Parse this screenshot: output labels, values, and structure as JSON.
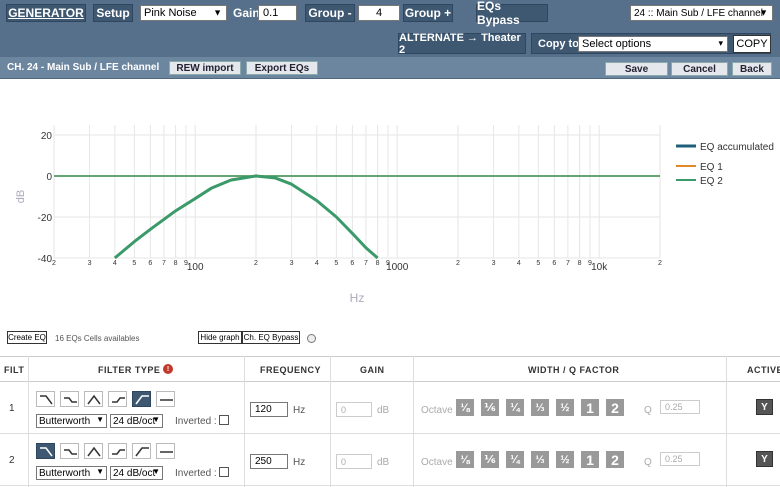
{
  "toolbar": {
    "generator_label": "GENERATOR",
    "setup_label": "Setup",
    "noise_select": "Pink Noise",
    "gain_label": "Gain",
    "gain_value": "0.1",
    "group_minus_label": "Group -",
    "group_value": "4",
    "group_plus_label": "Group +",
    "eqs_bypass_label": "EQs Bypass",
    "channel_select": "24 :: Main Sub / LFE channel",
    "alternate_label": "ALTERNATE → Theater 2",
    "copy_to_label": "Copy to :",
    "copy_select": "Select options",
    "copy_button": "COPY"
  },
  "subbar": {
    "channel_title": "CH. 24 - Main Sub / LFE channel",
    "rew_import": "REW import",
    "export_eqs": "Export EQs",
    "save": "Save",
    "cancel": "Cancel",
    "back": "Back"
  },
  "chart_data": {
    "type": "line",
    "xlabel": "Hz",
    "ylabel": "dB",
    "xscale": "log",
    "xlim": [
      20,
      20000
    ],
    "ylim": [
      -40,
      20
    ],
    "yticks": [
      20,
      0,
      -20,
      -40
    ],
    "xtick_labels": [
      "2",
      "3",
      "4",
      "5",
      "6",
      "7",
      "8",
      "9",
      "100",
      "2",
      "3",
      "4",
      "5",
      "6",
      "7",
      "8",
      "9",
      "1000",
      "2",
      "3",
      "4",
      "5",
      "6",
      "7",
      "8",
      "9",
      "10k",
      "2"
    ],
    "legend_position": "right",
    "legend": [
      "EQ accumulated",
      "EQ 1",
      "EQ 2"
    ],
    "series": [
      {
        "name": "EQ accumulated",
        "color": "#1f5f7a",
        "x": [
          40,
          50,
          60,
          80,
          100,
          120,
          150,
          200,
          250,
          300,
          400,
          500,
          600,
          700,
          800
        ],
        "y": [
          -40,
          -32,
          -26,
          -17,
          -11,
          -6,
          -2,
          0,
          -1,
          -4,
          -12,
          -20,
          -28,
          -35,
          -40
        ]
      },
      {
        "name": "EQ 1",
        "color": "#e08a2b",
        "x": [
          20,
          20000
        ],
        "y": [
          0,
          0
        ],
        "x_hp": [
          40,
          50,
          60,
          80,
          100,
          120,
          150,
          200
        ]
      },
      {
        "name": "EQ 2",
        "color": "#3a9a6a",
        "x": [
          20,
          20000
        ],
        "y": [
          0,
          0
        ]
      }
    ]
  },
  "graph_controls": {
    "create_eq": "Create EQ",
    "cells_available": "16 EQs Cells availables",
    "hide_graph": "Hide graph",
    "ch_eq_bypass": "Ch. EQ Bypass"
  },
  "table": {
    "headers": {
      "filt": "FILT",
      "filter_type": "FILTER TYPE",
      "frequency": "FREQUENCY",
      "gain": "GAIN",
      "width": "WIDTH / Q FACTOR",
      "active": "ACTIVE"
    },
    "rows": [
      {
        "index": "1",
        "filter": "Butterworth",
        "slope": "24 dB/oct",
        "inverted": "Inverted :",
        "frequency": "120",
        "hz": "Hz",
        "gain": "0",
        "db": "dB",
        "octave": "Octave",
        "q_label": "Q",
        "q_value": "0.25",
        "active": "Y"
      },
      {
        "index": "2",
        "filter": "Butterworth",
        "slope": "24 dB/oct",
        "inverted": "Inverted :",
        "frequency": "250",
        "hz": "Hz",
        "gain": "0",
        "db": "dB",
        "octave": "Octave",
        "q_label": "Q",
        "q_value": "0.25",
        "active": "Y"
      }
    ],
    "octave_buttons": [
      "⅛",
      "⅙",
      "¼",
      "⅓",
      "½",
      "1",
      "2"
    ]
  }
}
